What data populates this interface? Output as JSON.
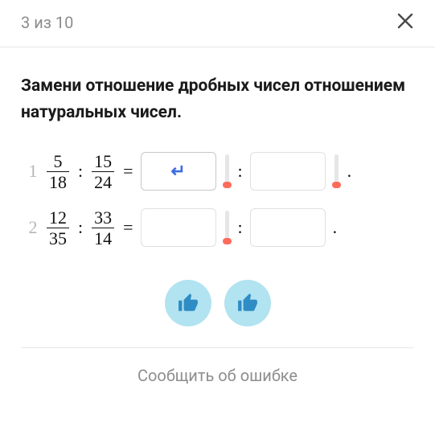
{
  "header": {
    "progress": "3 из 10"
  },
  "prompt": "Замени отношение дробных чисел отношением натуральных чисел.",
  "problems": [
    {
      "index": "1",
      "frac1": {
        "num": "5",
        "den": "18"
      },
      "frac2": {
        "num": "15",
        "den": "24"
      },
      "active": true
    },
    {
      "index": "2",
      "frac1": {
        "num": "12",
        "den": "35"
      },
      "frac2": {
        "num": "33",
        "den": "14"
      },
      "active": false
    }
  ],
  "symbols": {
    "colon": ":",
    "equals": "=",
    "dot": "."
  },
  "report_label": "Сообщить об ошибке"
}
